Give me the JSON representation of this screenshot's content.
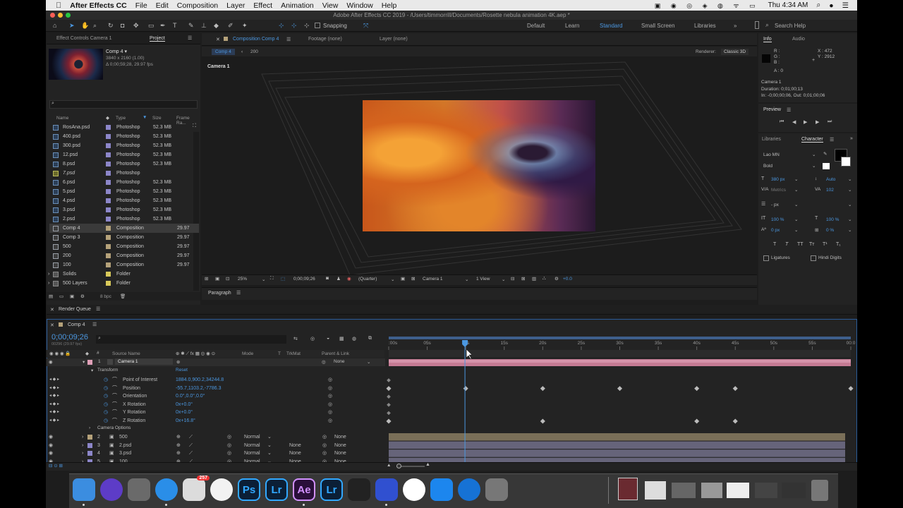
{
  "menubar": {
    "apple": "",
    "app_name": "After Effects CC",
    "items": [
      "File",
      "Edit",
      "Composition",
      "Layer",
      "Effect",
      "Animation",
      "View",
      "Window",
      "Help"
    ],
    "clock": "Thu 4:34 AM"
  },
  "title": "Adobe After Effects CC 2019 - /Users/timmorrill/Documents/Rosette nebula animation 4K.aep *",
  "toolbar": {
    "snapping": "Snapping",
    "workspaces": [
      "Default",
      "Learn",
      "Standard",
      "Small Screen",
      "Libraries"
    ],
    "active_workspace": "Standard",
    "search_placeholder": "Search Help"
  },
  "project_panel": {
    "tabs": [
      "Effect Controls Camera 1",
      "Project"
    ],
    "active_tab": "Project",
    "thumb_name": "Comp 4 ▾",
    "thumb_info1": "3840 x 2160 (1.00)",
    "thumb_info2": "Δ 0;00;59;28, 29.97 fps",
    "columns": {
      "name": "Name",
      "type": "Type",
      "size": "Size",
      "frame_rate": "Frame Ra..."
    },
    "rows": [
      {
        "name": "RosAna.psd",
        "type": "Photoshop",
        "size": "52.3 MB",
        "rate": "",
        "color": "#8c86c9",
        "kind": "file"
      },
      {
        "name": "400.psd",
        "type": "Photoshop",
        "size": "52.3 MB",
        "rate": "",
        "color": "#8c86c9",
        "kind": "file"
      },
      {
        "name": "300.psd",
        "type": "Photoshop",
        "size": "52.3 MB",
        "rate": "",
        "color": "#8c86c9",
        "kind": "file"
      },
      {
        "name": "12.psd",
        "type": "Photoshop",
        "size": "52.3 MB",
        "rate": "",
        "color": "#8c86c9",
        "kind": "file"
      },
      {
        "name": "8.psd",
        "type": "Photoshop",
        "size": "52.3 MB",
        "rate": "",
        "color": "#8c86c9",
        "kind": "file"
      },
      {
        "name": "7.psd",
        "type": "Photoshop",
        "size": "",
        "rate": "",
        "color": "#8c86c9",
        "kind": "missing"
      },
      {
        "name": "6.psd",
        "type": "Photoshop",
        "size": "52.3 MB",
        "rate": "",
        "color": "#8c86c9",
        "kind": "file"
      },
      {
        "name": "5.psd",
        "type": "Photoshop",
        "size": "52.3 MB",
        "rate": "",
        "color": "#8c86c9",
        "kind": "file"
      },
      {
        "name": "4.psd",
        "type": "Photoshop",
        "size": "52.3 MB",
        "rate": "",
        "color": "#8c86c9",
        "kind": "file"
      },
      {
        "name": "3.psd",
        "type": "Photoshop",
        "size": "52.3 MB",
        "rate": "",
        "color": "#8c86c9",
        "kind": "file"
      },
      {
        "name": "2.psd",
        "type": "Photoshop",
        "size": "52.3 MB",
        "rate": "",
        "color": "#8c86c9",
        "kind": "file"
      },
      {
        "name": "Comp 4",
        "type": "Composition",
        "size": "",
        "rate": "29.97",
        "color": "#b5a27a",
        "kind": "comp",
        "selected": true
      },
      {
        "name": "Comp 3",
        "type": "Composition",
        "size": "",
        "rate": "29.97",
        "color": "#b5a27a",
        "kind": "comp"
      },
      {
        "name": "500",
        "type": "Composition",
        "size": "",
        "rate": "29.97",
        "color": "#b5a27a",
        "kind": "comp"
      },
      {
        "name": "200",
        "type": "Composition",
        "size": "",
        "rate": "29.97",
        "color": "#b5a27a",
        "kind": "comp"
      },
      {
        "name": "100",
        "type": "Composition",
        "size": "",
        "rate": "29.97",
        "color": "#b5a27a",
        "kind": "comp"
      },
      {
        "name": "Solids",
        "type": "Folder",
        "size": "",
        "rate": "",
        "color": "#d8c95a",
        "kind": "folder"
      },
      {
        "name": "500 Layers",
        "type": "Folder",
        "size": "",
        "rate": "",
        "color": "#d8c95a",
        "kind": "folder"
      }
    ],
    "bpc": "8 bpc"
  },
  "comp_panel": {
    "tabs": [
      "Composition Comp 4",
      "Footage (none)",
      "Layer (none)"
    ],
    "breadcrumb": [
      "Comp 4",
      "200"
    ],
    "renderer_label": "Renderer:",
    "renderer": "Classic 3D",
    "camera_label": "Camera 1",
    "zoom": "25%",
    "timecode": "0;00;09;26",
    "resolution": "(Quarter)",
    "view_camera": "Camera 1",
    "views": "1 View",
    "exposure": "+0.0"
  },
  "paragraph_panel": {
    "title": "Paragraph"
  },
  "info_panel": {
    "tabs": [
      "Info",
      "Audio"
    ],
    "r": "R :",
    "g": "G :",
    "b": "B :",
    "a": "A : 0",
    "x": "X : 472",
    "y": "Y : 2912",
    "layer": "Camera 1",
    "duration": "Duration: 0;01;00;13",
    "inout": "In: -0;00;00;06, Out: 0;01;00;06"
  },
  "preview_panel": {
    "title": "Preview"
  },
  "character_panel": {
    "tabs": [
      "Libraries",
      "Character"
    ],
    "font": "Lao MN",
    "style": "Bold",
    "size": "380 px",
    "leading": "Auto",
    "kerning": "Metrics",
    "tracking": "102",
    "stroke": "- px",
    "vscale": "100 %",
    "hscale": "100 %",
    "baseline": "0 px",
    "tsume": "0 %",
    "styles": [
      "T",
      "T",
      "TT",
      "Tт",
      "T¹",
      "T₁"
    ],
    "ligatures": "Ligatures",
    "hindi": "Hindi Digits"
  },
  "render_queue": {
    "title": "Render Queue"
  },
  "timeline": {
    "tab": "Comp 4",
    "timecode": "0;00;09;26",
    "frame_info": "00296 (29.97 fps)",
    "columns": {
      "source": "Source Name",
      "mode": "Mode",
      "t": "T",
      "trkmat": "TrkMat",
      "parent": "Parent & Link"
    },
    "ruler": [
      ":00s",
      "05s",
      "10s",
      "15s",
      "20s",
      "25s",
      "30s",
      "35s",
      "40s",
      "45s",
      "50s",
      "55s",
      "00:0"
    ],
    "playhead_seconds": 9.9,
    "duration_seconds": 60,
    "layer1": {
      "num": "1",
      "name": "Camera 1",
      "parent": "None"
    },
    "transform": {
      "label": "Transform",
      "reset": "Reset"
    },
    "properties": [
      {
        "name": "Point of Interest",
        "value": "1884.0,900.2,34244.8"
      },
      {
        "name": "Position",
        "value": "-55.7,1103.2,-7786.3"
      },
      {
        "name": "Orientation",
        "value": "0.0°,0.0°,0.0°"
      },
      {
        "name": "X Rotation",
        "value": "0x+0.0°"
      },
      {
        "name": "Y Rotation",
        "value": "0x+0.0°"
      },
      {
        "name": "Z Rotation",
        "value": "0x+16.8°"
      }
    ],
    "camera_options": "Camera Options",
    "layers": [
      {
        "num": "2",
        "name": "500",
        "mode": "Normal",
        "trkmat": "",
        "parent": "None"
      },
      {
        "num": "3",
        "name": "2.psd",
        "mode": "Normal",
        "trkmat": "None",
        "parent": "None"
      },
      {
        "num": "4",
        "name": "3.psd",
        "mode": "Normal",
        "trkmat": "None",
        "parent": "None"
      },
      {
        "num": "5",
        "name": "100",
        "mode": "Normal",
        "trkmat": "None",
        "parent": "None"
      }
    ]
  },
  "dock": {
    "apps": [
      {
        "name": "Finder",
        "label": ""
      },
      {
        "name": "Siri",
        "label": ""
      },
      {
        "name": "Launchpad",
        "label": ""
      },
      {
        "name": "Safari",
        "label": ""
      },
      {
        "name": "Photos Stamp",
        "label": "",
        "badge": "257"
      },
      {
        "name": "Photos",
        "label": ""
      },
      {
        "name": "Photoshop",
        "label": "Ps"
      },
      {
        "name": "Lightroom Classic",
        "label": "Lr"
      },
      {
        "name": "After Effects",
        "label": "Ae"
      },
      {
        "name": "Lightroom",
        "label": "Lr"
      },
      {
        "name": "Final Cut Pro",
        "label": ""
      },
      {
        "name": "Affinity",
        "label": ""
      },
      {
        "name": "Music",
        "label": ""
      },
      {
        "name": "App Store",
        "label": ""
      },
      {
        "name": "TeamViewer",
        "label": ""
      },
      {
        "name": "System Preferences",
        "label": ""
      }
    ]
  }
}
